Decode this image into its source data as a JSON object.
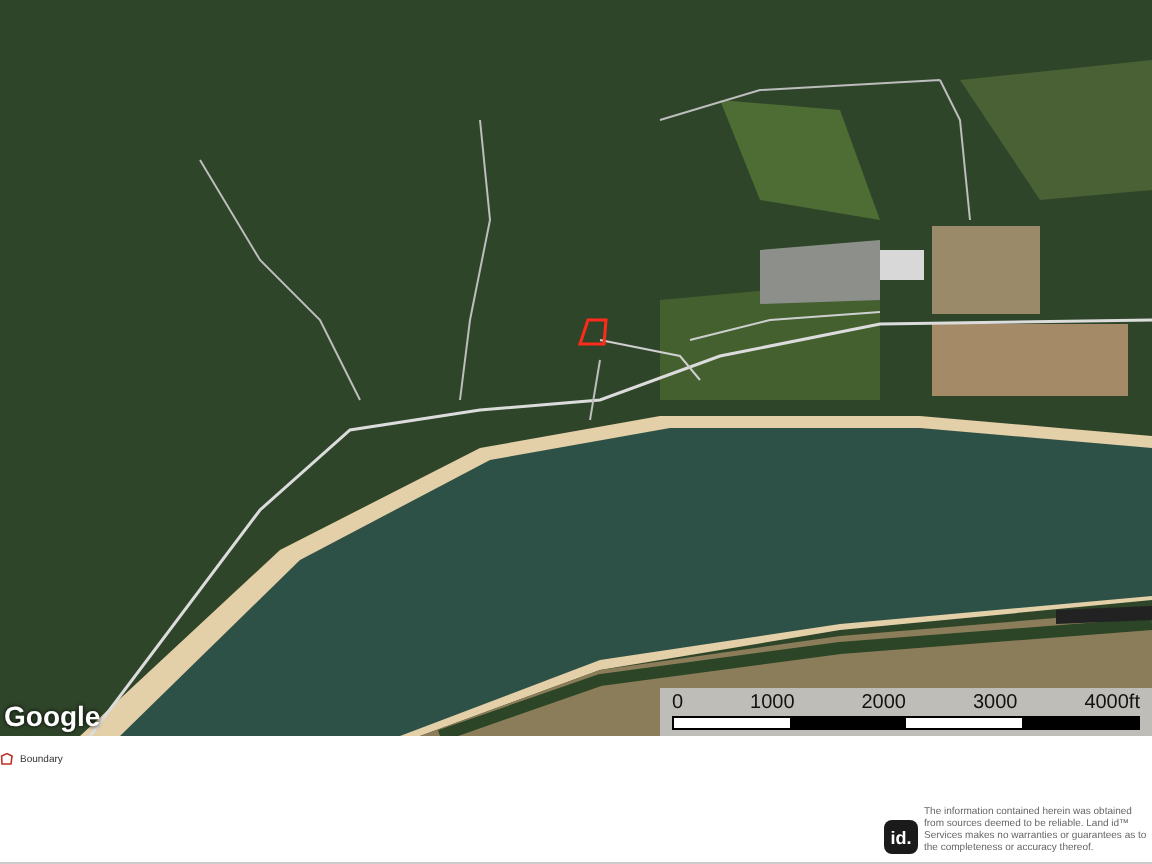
{
  "map": {
    "attribution": "Google"
  },
  "scale_bar": {
    "ticks": [
      "0",
      "1000",
      "2000",
      "3000",
      "4000ft"
    ]
  },
  "legend": [
    {
      "kind": "boundary",
      "label": "Boundary"
    }
  ],
  "footer": {
    "logo": "id.",
    "disclaimer": "The information contained herein was obtained from sources deemed to be reliable. Land id™ Services makes no warranties or guarantees as to the completeness or accuracy thereof."
  }
}
